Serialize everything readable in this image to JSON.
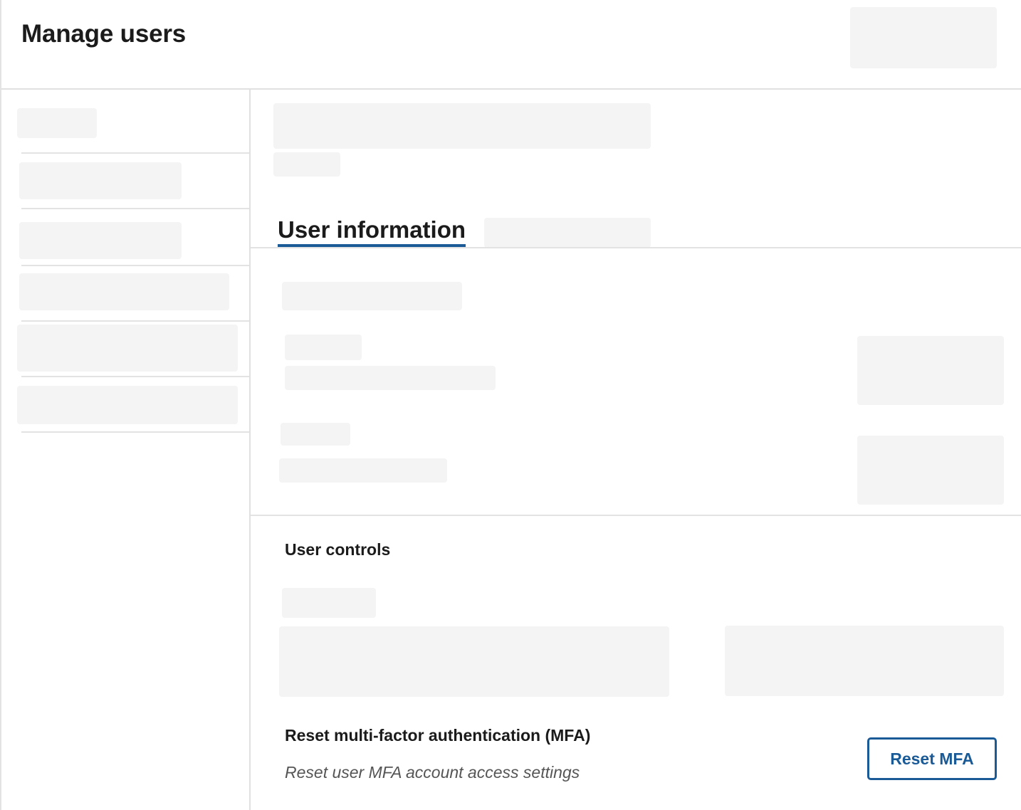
{
  "header": {
    "title": "Manage users"
  },
  "main": {
    "tabs": [
      {
        "label": "User information",
        "active": true
      }
    ],
    "user_controls": {
      "heading": "User controls",
      "mfa": {
        "title": "Reset multi-factor authentication (MFA)",
        "description": "Reset user MFA account access settings",
        "button_label": "Reset MFA"
      }
    }
  },
  "colors": {
    "accent": "#1a5a96",
    "skeleton": "#f4f4f4",
    "divider": "#e3e3e3"
  }
}
